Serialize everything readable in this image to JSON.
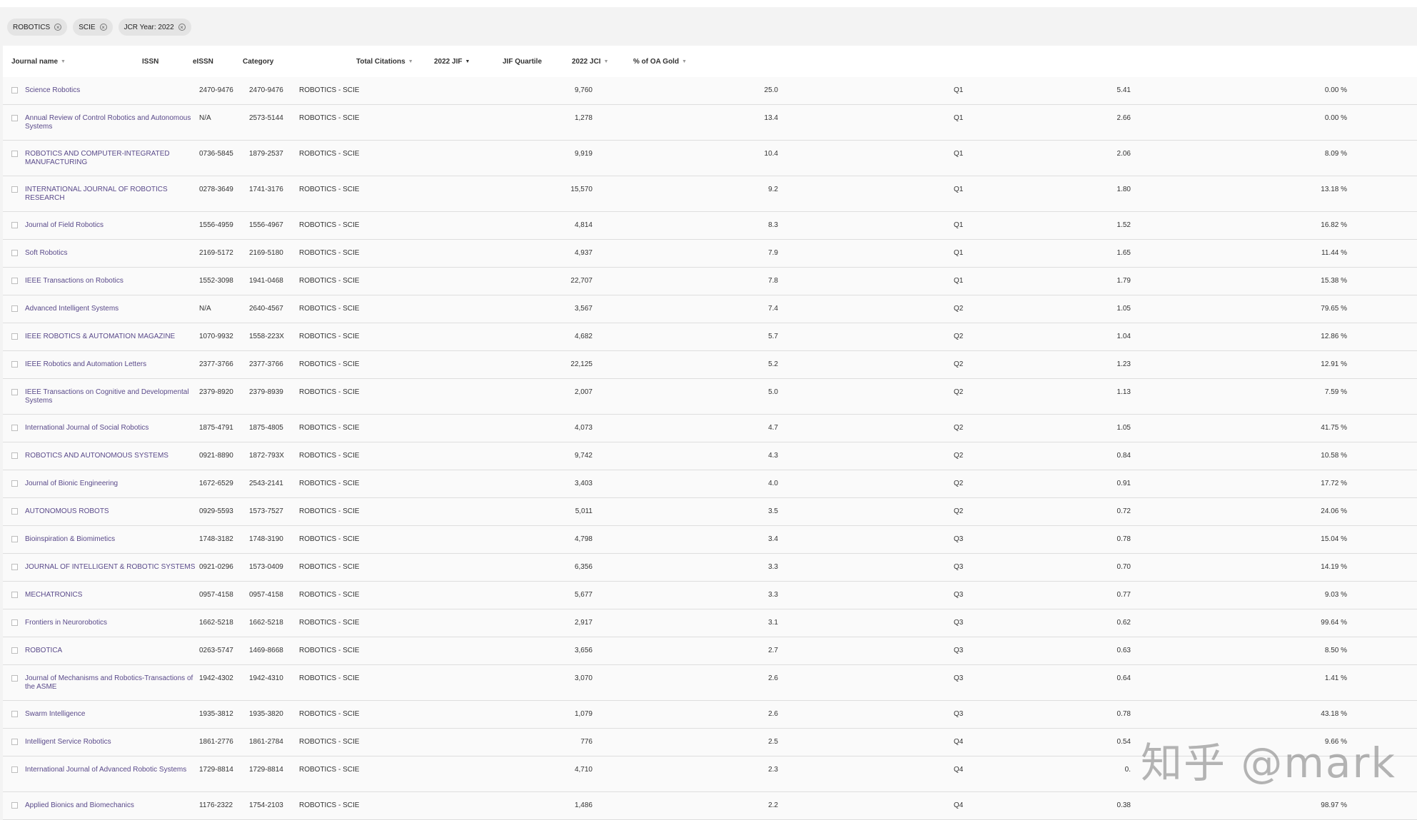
{
  "filters": [
    {
      "label": "ROBOTICS"
    },
    {
      "label": "SCIE"
    },
    {
      "label": "JCR Year: 2022"
    }
  ],
  "filter_remove_glyph": "×",
  "columns": {
    "journal_name": "Journal name",
    "issn": "ISSN",
    "eissn": "eISSN",
    "category": "Category",
    "total_citations": "Total Citations",
    "jif": "2022 JIF",
    "jif_quartile": "JIF Quartile",
    "jci": "2022 JCI",
    "oa_gold": "% of OA Gold"
  },
  "sort_glyphs": {
    "inactive": "▼",
    "active": "▼"
  },
  "rows": [
    {
      "name": "Science Robotics",
      "issn": "2470-9476",
      "eissn": "2470-9476",
      "category": "ROBOTICS - SCIE",
      "citations": "9,760",
      "jif": "25.0",
      "quartile": "Q1",
      "jci": "5.41",
      "oa": "0.00 %"
    },
    {
      "name": "Annual Review of Control Robotics and Autonomous Systems",
      "issn": "N/A",
      "eissn": "2573-5144",
      "category": "ROBOTICS - SCIE",
      "citations": "1,278",
      "jif": "13.4",
      "quartile": "Q1",
      "jci": "2.66",
      "oa": "0.00 %"
    },
    {
      "name": "ROBOTICS AND COMPUTER-INTEGRATED MANUFACTURING",
      "issn": "0736-5845",
      "eissn": "1879-2537",
      "category": "ROBOTICS - SCIE",
      "citations": "9,919",
      "jif": "10.4",
      "quartile": "Q1",
      "jci": "2.06",
      "oa": "8.09 %"
    },
    {
      "name": "INTERNATIONAL JOURNAL OF ROBOTICS RESEARCH",
      "issn": "0278-3649",
      "eissn": "1741-3176",
      "category": "ROBOTICS - SCIE",
      "citations": "15,570",
      "jif": "9.2",
      "quartile": "Q1",
      "jci": "1.80",
      "oa": "13.18 %"
    },
    {
      "name": "Journal of Field Robotics",
      "issn": "1556-4959",
      "eissn": "1556-4967",
      "category": "ROBOTICS - SCIE",
      "citations": "4,814",
      "jif": "8.3",
      "quartile": "Q1",
      "jci": "1.52",
      "oa": "16.82 %"
    },
    {
      "name": "Soft Robotics",
      "issn": "2169-5172",
      "eissn": "2169-5180",
      "category": "ROBOTICS - SCIE",
      "citations": "4,937",
      "jif": "7.9",
      "quartile": "Q1",
      "jci": "1.65",
      "oa": "11.44 %"
    },
    {
      "name": "IEEE Transactions on Robotics",
      "issn": "1552-3098",
      "eissn": "1941-0468",
      "category": "ROBOTICS - SCIE",
      "citations": "22,707",
      "jif": "7.8",
      "quartile": "Q1",
      "jci": "1.79",
      "oa": "15.38 %"
    },
    {
      "name": "Advanced Intelligent Systems",
      "issn": "N/A",
      "eissn": "2640-4567",
      "category": "ROBOTICS - SCIE",
      "citations": "3,567",
      "jif": "7.4",
      "quartile": "Q2",
      "jci": "1.05",
      "oa": "79.65 %"
    },
    {
      "name": "IEEE ROBOTICS & AUTOMATION MAGAZINE",
      "issn": "1070-9932",
      "eissn": "1558-223X",
      "category": "ROBOTICS - SCIE",
      "citations": "4,682",
      "jif": "5.7",
      "quartile": "Q2",
      "jci": "1.04",
      "oa": "12.86 %"
    },
    {
      "name": "IEEE Robotics and Automation Letters",
      "issn": "2377-3766",
      "eissn": "2377-3766",
      "category": "ROBOTICS - SCIE",
      "citations": "22,125",
      "jif": "5.2",
      "quartile": "Q2",
      "jci": "1.23",
      "oa": "12.91 %"
    },
    {
      "name": "IEEE Transactions on Cognitive and Developmental Systems",
      "issn": "2379-8920",
      "eissn": "2379-8939",
      "category": "ROBOTICS - SCIE",
      "citations": "2,007",
      "jif": "5.0",
      "quartile": "Q2",
      "jci": "1.13",
      "oa": "7.59 %"
    },
    {
      "name": "International Journal of Social Robotics",
      "issn": "1875-4791",
      "eissn": "1875-4805",
      "category": "ROBOTICS - SCIE",
      "citations": "4,073",
      "jif": "4.7",
      "quartile": "Q2",
      "jci": "1.05",
      "oa": "41.75 %"
    },
    {
      "name": "ROBOTICS AND AUTONOMOUS SYSTEMS",
      "issn": "0921-8890",
      "eissn": "1872-793X",
      "category": "ROBOTICS - SCIE",
      "citations": "9,742",
      "jif": "4.3",
      "quartile": "Q2",
      "jci": "0.84",
      "oa": "10.58 %"
    },
    {
      "name": "Journal of Bionic Engineering",
      "issn": "1672-6529",
      "eissn": "2543-2141",
      "category": "ROBOTICS - SCIE",
      "citations": "3,403",
      "jif": "4.0",
      "quartile": "Q2",
      "jci": "0.91",
      "oa": "17.72 %"
    },
    {
      "name": "AUTONOMOUS ROBOTS",
      "issn": "0929-5593",
      "eissn": "1573-7527",
      "category": "ROBOTICS - SCIE",
      "citations": "5,011",
      "jif": "3.5",
      "quartile": "Q2",
      "jci": "0.72",
      "oa": "24.06 %"
    },
    {
      "name": "Bioinspiration & Biomimetics",
      "issn": "1748-3182",
      "eissn": "1748-3190",
      "category": "ROBOTICS - SCIE",
      "citations": "4,798",
      "jif": "3.4",
      "quartile": "Q3",
      "jci": "0.78",
      "oa": "15.04 %"
    },
    {
      "name": "JOURNAL OF INTELLIGENT & ROBOTIC SYSTEMS",
      "issn": "0921-0296",
      "eissn": "1573-0409",
      "category": "ROBOTICS - SCIE",
      "citations": "6,356",
      "jif": "3.3",
      "quartile": "Q3",
      "jci": "0.70",
      "oa": "14.19 %"
    },
    {
      "name": "MECHATRONICS",
      "issn": "0957-4158",
      "eissn": "0957-4158",
      "category": "ROBOTICS - SCIE",
      "citations": "5,677",
      "jif": "3.3",
      "quartile": "Q3",
      "jci": "0.77",
      "oa": "9.03 %"
    },
    {
      "name": "Frontiers in Neurorobotics",
      "issn": "1662-5218",
      "eissn": "1662-5218",
      "category": "ROBOTICS - SCIE",
      "citations": "2,917",
      "jif": "3.1",
      "quartile": "Q3",
      "jci": "0.62",
      "oa": "99.64 %"
    },
    {
      "name": "ROBOTICA",
      "issn": "0263-5747",
      "eissn": "1469-8668",
      "category": "ROBOTICS - SCIE",
      "citations": "3,656",
      "jif": "2.7",
      "quartile": "Q3",
      "jci": "0.63",
      "oa": "8.50 %"
    },
    {
      "name": "Journal of Mechanisms and Robotics-Transactions of the ASME",
      "issn": "1942-4302",
      "eissn": "1942-4310",
      "category": "ROBOTICS - SCIE",
      "citations": "3,070",
      "jif": "2.6",
      "quartile": "Q3",
      "jci": "0.64",
      "oa": "1.41 %"
    },
    {
      "name": "Swarm Intelligence",
      "issn": "1935-3812",
      "eissn": "1935-3820",
      "category": "ROBOTICS - SCIE",
      "citations": "1,079",
      "jif": "2.6",
      "quartile": "Q3",
      "jci": "0.78",
      "oa": "43.18 %"
    },
    {
      "name": "Intelligent Service Robotics",
      "issn": "1861-2776",
      "eissn": "1861-2784",
      "category": "ROBOTICS - SCIE",
      "citations": "776",
      "jif": "2.5",
      "quartile": "Q4",
      "jci": "0.54",
      "oa": "9.66 %"
    },
    {
      "name": "International Journal of Advanced Robotic Systems",
      "issn": "1729-8814",
      "eissn": "1729-8814",
      "category": "ROBOTICS - SCIE",
      "citations": "4,710",
      "jif": "2.3",
      "quartile": "Q4",
      "jci": "0.",
      "oa": ""
    },
    {
      "name": "Applied Bionics and Biomechanics",
      "issn": "1176-2322",
      "eissn": "1754-2103",
      "category": "ROBOTICS - SCIE",
      "citations": "1,486",
      "jif": "2.2",
      "quartile": "Q4",
      "jci": "0.38",
      "oa": "98.97 %"
    }
  ],
  "watermark": "知乎 @mark"
}
